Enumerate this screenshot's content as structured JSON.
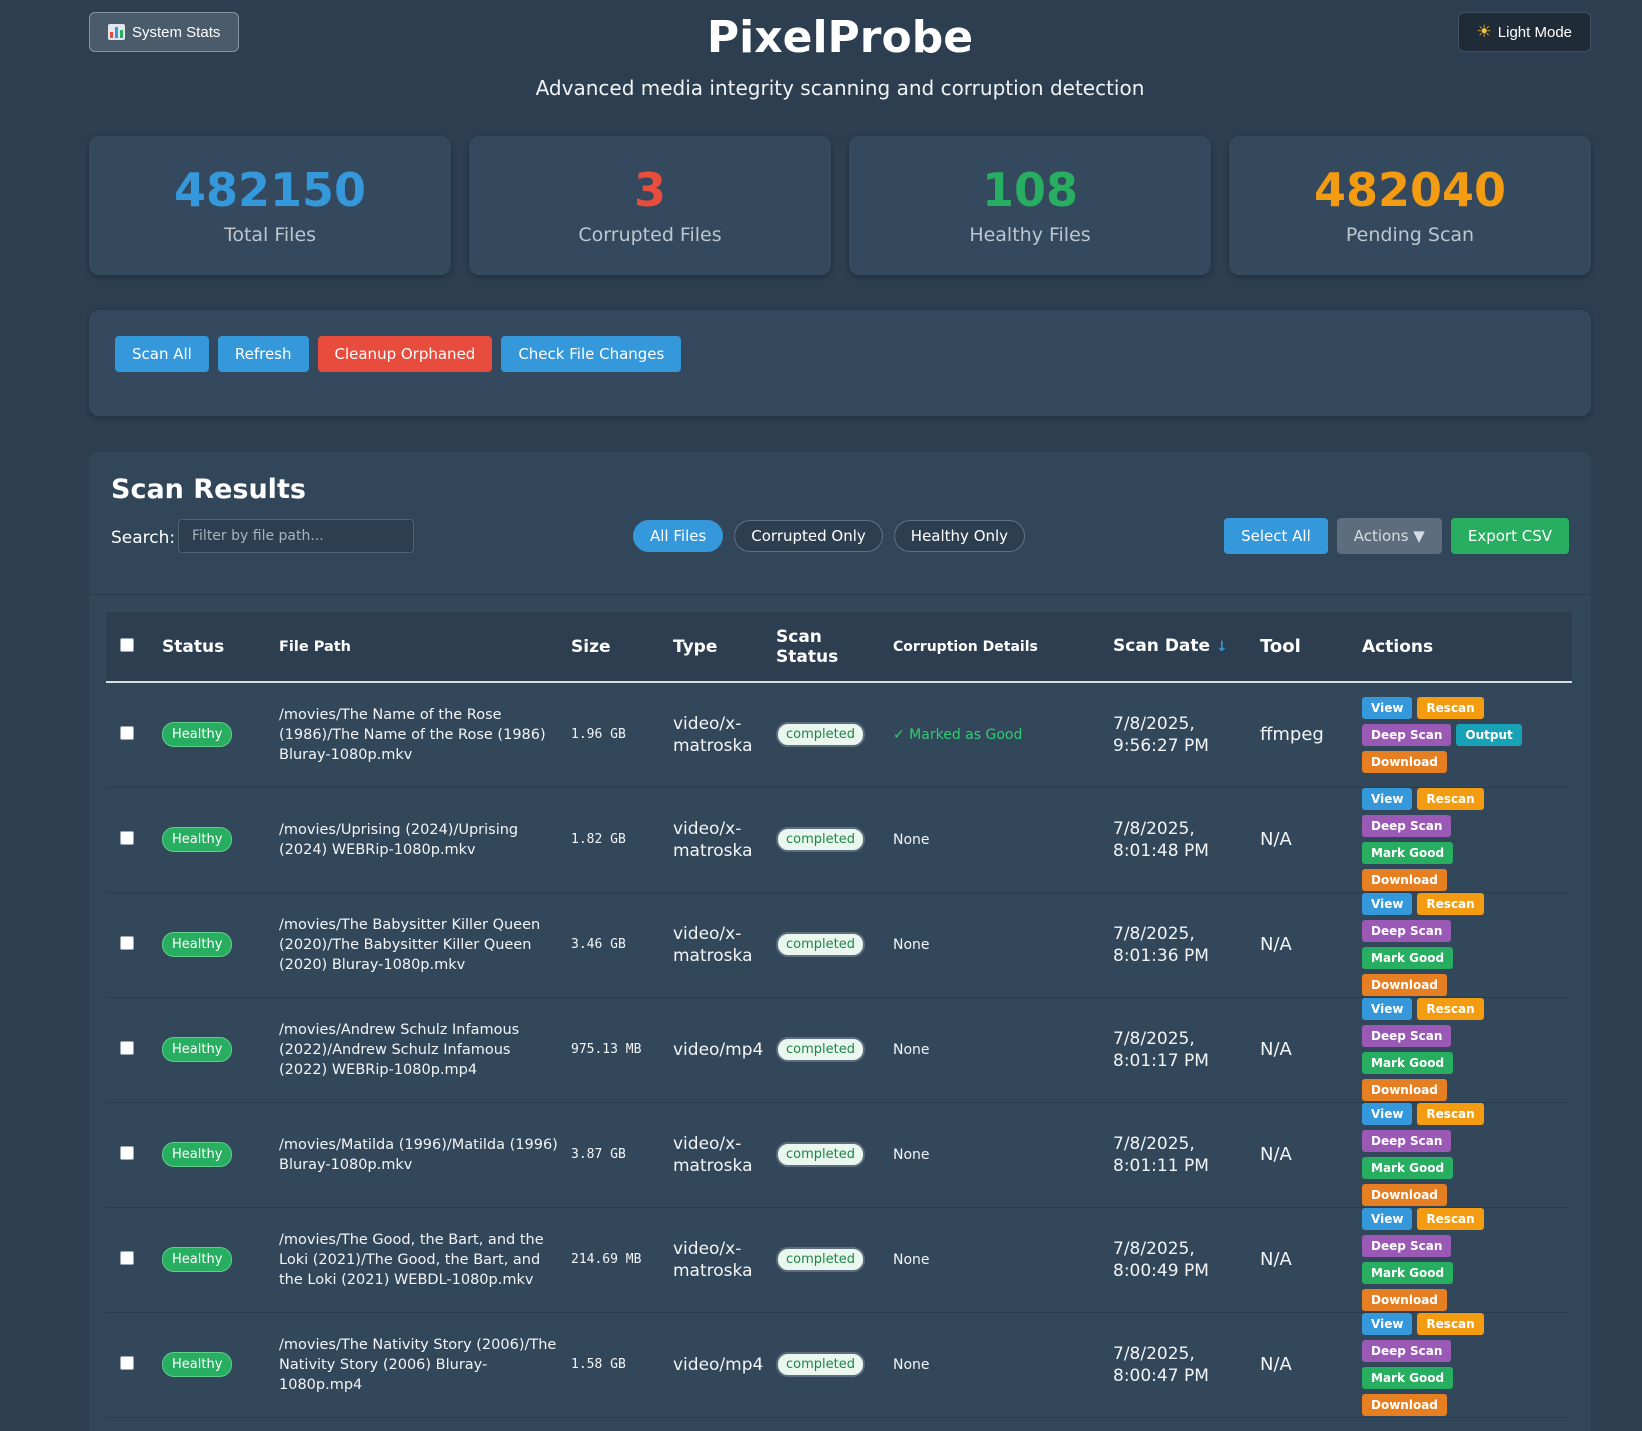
{
  "header": {
    "stats_button": "System Stats",
    "mode_button": "Light Mode",
    "title": "PixelProbe",
    "subtitle": "Advanced media integrity scanning and corruption detection"
  },
  "stats": [
    {
      "value": "482150",
      "label": "Total Files",
      "color": "#3498db"
    },
    {
      "value": "3",
      "label": "Corrupted Files",
      "color": "#e74c3c"
    },
    {
      "value": "108",
      "label": "Healthy Files",
      "color": "#27ae60"
    },
    {
      "value": "482040",
      "label": "Pending Scan",
      "color": "#f39c12"
    }
  ],
  "controls": {
    "scan_all": "Scan All",
    "refresh": "Refresh",
    "cleanup": "Cleanup Orphaned",
    "check_changes": "Check File Changes"
  },
  "results": {
    "title": "Scan Results",
    "search_label": "Search:",
    "search_placeholder": "Filter by file path...",
    "filters": [
      "All Files",
      "Corrupted Only",
      "Healthy Only"
    ],
    "select_all": "Select All",
    "actions": "Actions ▼",
    "export": "Export CSV"
  },
  "table": {
    "headers": {
      "status": "Status",
      "path": "File Path",
      "size": "Size",
      "type": "Type",
      "scan_status": "Scan Status",
      "corruption": "Corruption Details",
      "scan_date": "Scan Date",
      "sort_arrow": "↓",
      "tool": "Tool",
      "actions": "Actions"
    },
    "rows": [
      {
        "status": "Healthy",
        "path": "/movies/The Name of the Rose (1986)/The Name of the Rose (1986) Bluray-1080p.mkv",
        "size": "1.96 GB",
        "type": "video/x-matroska",
        "scan_status": "completed",
        "corruption": "✓ Marked as Good",
        "date": "7/8/2025, 9:56:27 PM",
        "tool": "ffmpeg"
      },
      {
        "status": "Healthy",
        "path": "/movies/Uprising (2024)/Uprising (2024) WEBRip-1080p.mkv",
        "size": "1.82 GB",
        "type": "video/x-matroska",
        "scan_status": "completed",
        "corruption": "None",
        "date": "7/8/2025, 8:01:48 PM",
        "tool": "N/A"
      },
      {
        "status": "Healthy",
        "path": "/movies/The Babysitter Killer Queen (2020)/The Babysitter Killer Queen (2020) Bluray-1080p.mkv",
        "size": "3.46 GB",
        "type": "video/x-matroska",
        "scan_status": "completed",
        "corruption": "None",
        "date": "7/8/2025, 8:01:36 PM",
        "tool": "N/A"
      },
      {
        "status": "Healthy",
        "path": "/movies/Andrew Schulz Infamous (2022)/Andrew Schulz Infamous (2022) WEBRip-1080p.mp4",
        "size": "975.13 MB",
        "type": "video/mp4",
        "scan_status": "completed",
        "corruption": "None",
        "date": "7/8/2025, 8:01:17 PM",
        "tool": "N/A"
      },
      {
        "status": "Healthy",
        "path": "/movies/Matilda (1996)/Matilda (1996) Bluray-1080p.mkv",
        "size": "3.87 GB",
        "type": "video/x-matroska",
        "scan_status": "completed",
        "corruption": "None",
        "date": "7/8/2025, 8:01:11 PM",
        "tool": "N/A"
      },
      {
        "status": "Healthy",
        "path": "/movies/The Good, the Bart, and the Loki (2021)/The Good, the Bart, and the Loki (2021) WEBDL-1080p.mkv",
        "size": "214.69 MB",
        "type": "video/x-matroska",
        "scan_status": "completed",
        "corruption": "None",
        "date": "7/8/2025, 8:00:49 PM",
        "tool": "N/A"
      },
      {
        "status": "Healthy",
        "path": "/movies/The Nativity Story (2006)/The Nativity Story (2006) Bluray-1080p.mp4",
        "size": "1.58 GB",
        "type": "video/mp4",
        "scan_status": "completed",
        "corruption": "None",
        "date": "7/8/2025, 8:00:47 PM",
        "tool": "N/A"
      }
    ],
    "row_buttons": {
      "view": "View",
      "rescan": "Rescan",
      "deep_scan": "Deep Scan",
      "output": "Output",
      "mark_good": "Mark Good",
      "download": "Download"
    }
  }
}
